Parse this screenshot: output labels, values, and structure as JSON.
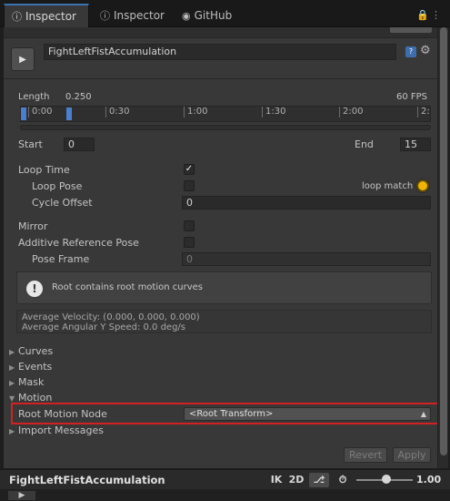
{
  "tabs": [
    {
      "label": "Inspector",
      "icon": "info-icon"
    },
    {
      "label": "Inspector",
      "icon": "info-icon"
    },
    {
      "label": "GitHub",
      "icon": "github-icon"
    }
  ],
  "clip": {
    "name": "FightLeftFistAccumulation"
  },
  "timeline": {
    "length_label": "Length",
    "length_value": "0.250",
    "fps": "60 FPS",
    "ticks": [
      "0:00",
      "0:30",
      "1:00",
      "1:30",
      "2:00",
      "2:"
    ]
  },
  "range": {
    "start_label": "Start",
    "start_value": "0",
    "end_label": "End",
    "end_value": "15"
  },
  "loop": {
    "loop_time_label": "Loop Time",
    "loop_time_checked": true,
    "loop_pose_label": "Loop Pose",
    "loop_pose_checked": false,
    "loop_match_label": "loop match",
    "loop_match_color": "#f0b400",
    "cycle_offset_label": "Cycle Offset",
    "cycle_offset_value": "0"
  },
  "options": {
    "mirror_label": "Mirror",
    "mirror_checked": false,
    "additive_label": "Additive Reference Pose",
    "additive_checked": false,
    "pose_frame_label": "Pose Frame",
    "pose_frame_value": "0"
  },
  "help": {
    "text": "Root contains root motion curves"
  },
  "stats": {
    "velocity": "Average Velocity: (0.000, 0.000, 0.000)",
    "angular": "Average Angular Y Speed: 0.0 deg/s"
  },
  "foldouts": [
    {
      "label": "Curves",
      "expanded": false
    },
    {
      "label": "Events",
      "expanded": false
    },
    {
      "label": "Mask",
      "expanded": false
    },
    {
      "label": "Motion",
      "expanded": true
    }
  ],
  "motion": {
    "root_motion_node_label": "Root Motion Node",
    "root_motion_node_value": "<Root Transform>",
    "highlight_color": "#d42020"
  },
  "import_messages_label": "Import Messages",
  "buttons": {
    "revert": "Revert",
    "apply": "Apply"
  },
  "preview": {
    "clip_name": "FightLeftFistAccumulation",
    "ik": "IK",
    "mode_2d": "2D",
    "speed": "1.00"
  }
}
